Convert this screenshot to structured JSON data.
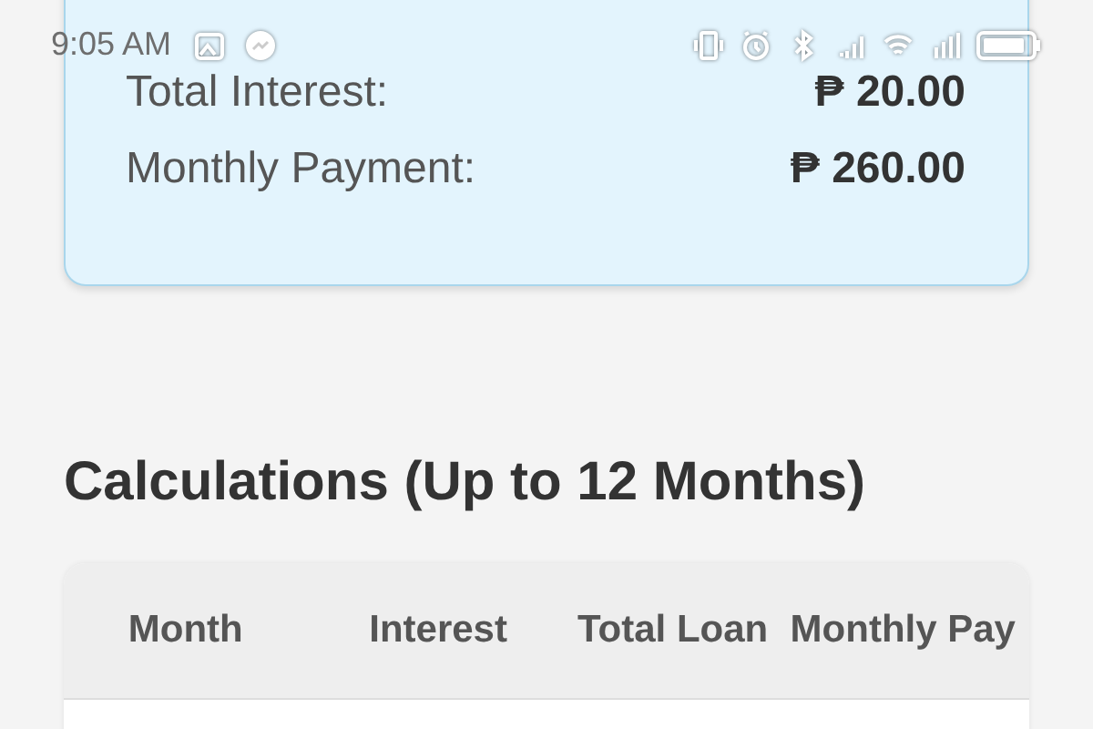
{
  "status_bar": {
    "time": "9:05 AM"
  },
  "summary": {
    "rows": [
      {
        "label": "Total Interest:",
        "value": "₱ 20.00"
      },
      {
        "label": "Monthly Payment:",
        "value": "₱ 260.00"
      }
    ]
  },
  "calculations": {
    "title": "Calculations (Up to 12 Months)",
    "columns": [
      "Month",
      "Interest",
      "Total Loan",
      "Monthly Pay"
    ]
  }
}
